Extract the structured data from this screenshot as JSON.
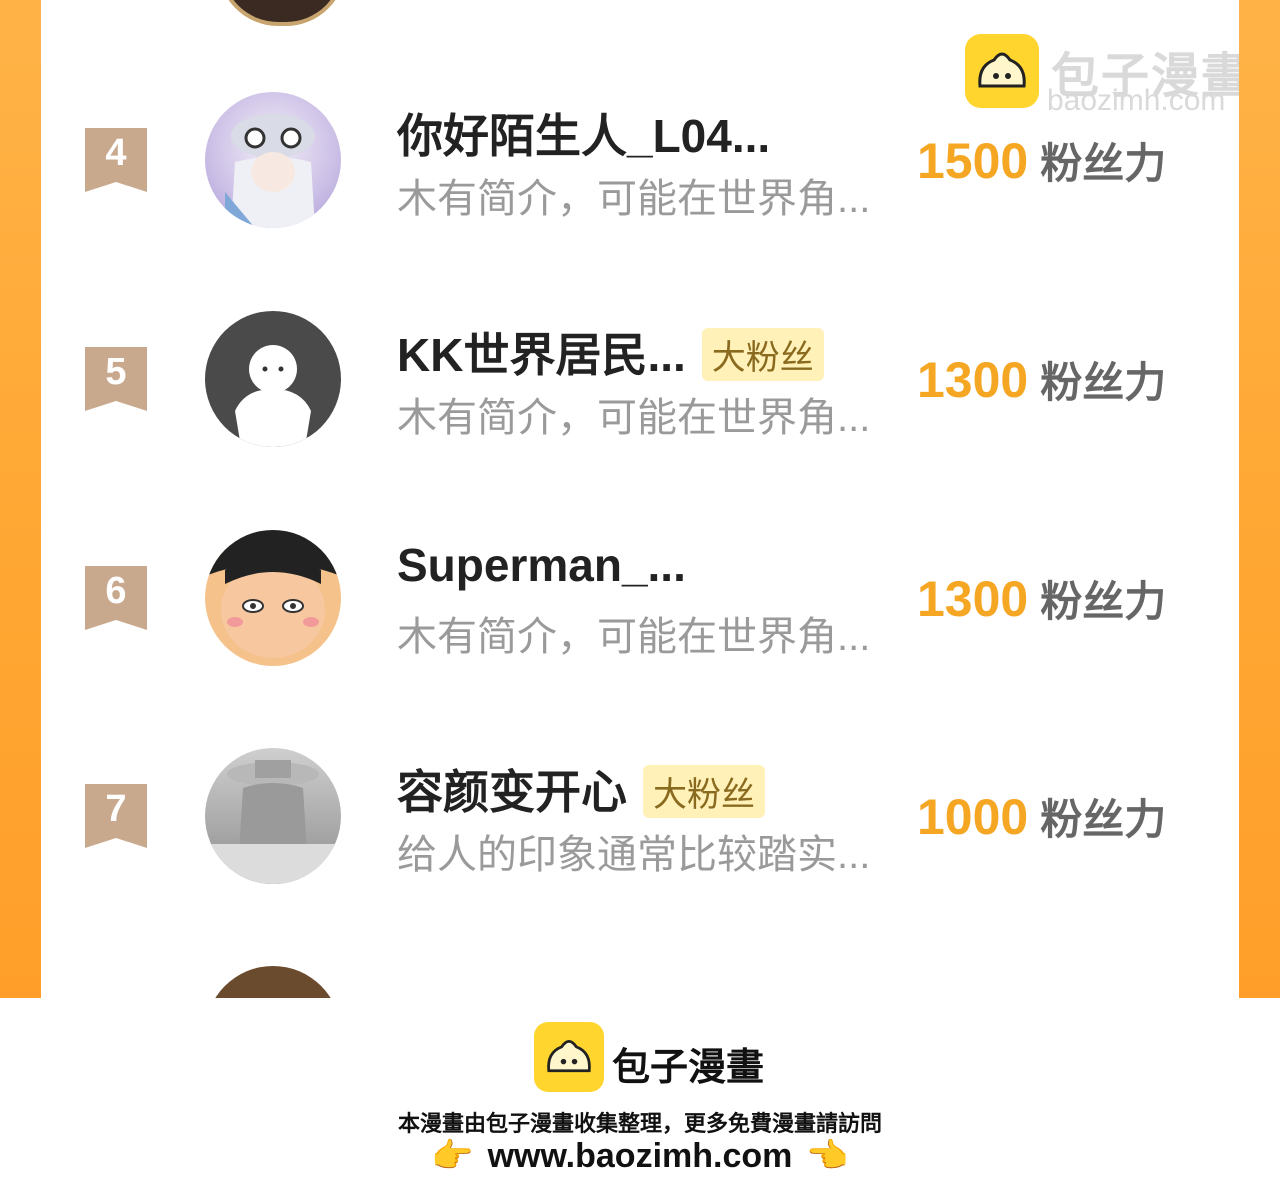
{
  "watermark": {
    "brand": "包子漫畫",
    "url": "baozimh.com"
  },
  "ranking": [
    {
      "rank": "4",
      "name": "你好陌生人_L04...",
      "badge": "",
      "desc": "木有简介，可能在世界角...",
      "score": "1500",
      "unit": "粉丝力",
      "avatar": "anime-girl-avatar"
    },
    {
      "rank": "5",
      "name": "KK世界居民...",
      "badge": "大粉丝",
      "desc": "木有简介，可能在世界角...",
      "score": "1300",
      "unit": "粉丝力",
      "avatar": "default-ghost-avatar"
    },
    {
      "rank": "6",
      "name": "Superman_...",
      "badge": "",
      "desc": "木有简介，可能在世界角...",
      "score": "1300",
      "unit": "粉丝力",
      "avatar": "cartoon-boy-avatar"
    },
    {
      "rank": "7",
      "name": "容颜变开心",
      "badge": "大粉丝",
      "desc": "给人的印象通常比较踏实...",
      "score": "1000",
      "unit": "粉丝力",
      "avatar": "photo-avatar"
    }
  ],
  "footer": {
    "brand": "包子漫畫",
    "line": "本漫畫由包子漫畫收集整理，更多免費漫畫請訪問",
    "url": "www.baozimh.com",
    "hand_left": "👉",
    "hand_right": "👈"
  },
  "colors": {
    "accent": "#f5a623",
    "side": "#ffa733",
    "badge_bg": "#fff1b8"
  }
}
